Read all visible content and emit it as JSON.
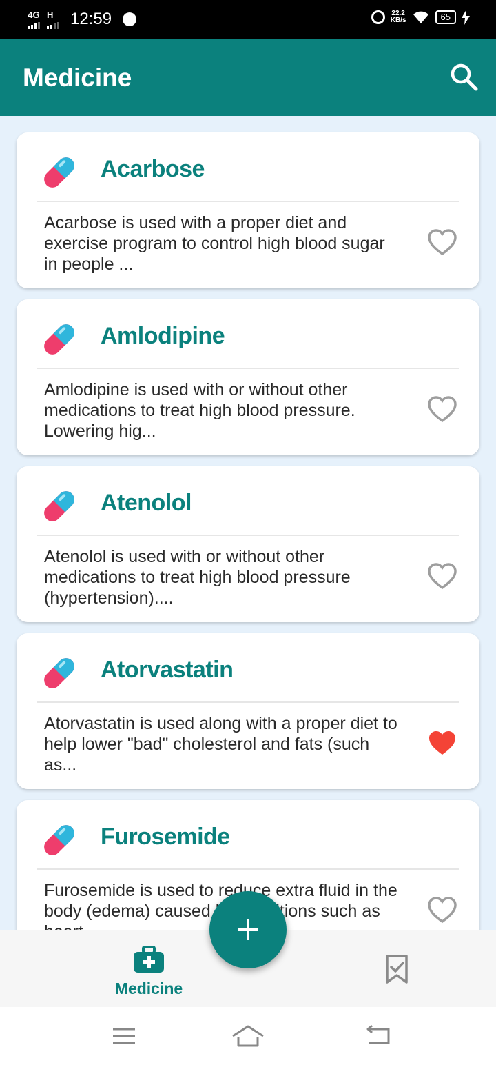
{
  "status_bar": {
    "network_1": "4G",
    "network_2": "H",
    "time": "12:59",
    "speed_value": "22.2",
    "speed_unit": "KB/s",
    "battery": "65"
  },
  "app_bar": {
    "title": "Medicine",
    "search_icon": "search-icon"
  },
  "medicines": [
    {
      "name": "Acarbose",
      "description": "Acarbose is used with a proper diet and exercise program to control high blood sugar in people ...",
      "favorite": false
    },
    {
      "name": "Amlodipine",
      "description": "Amlodipine is used with or without other medications to treat high blood pressure. Lowering hig...",
      "favorite": false
    },
    {
      "name": "Atenolol",
      "description": "Atenolol is used with or without other medications to treat high blood pressure (hypertension)....",
      "favorite": false
    },
    {
      "name": "Atorvastatin",
      "description": "Atorvastatin is used along with a proper diet to help lower \"bad\" cholesterol and fats (such as...",
      "favorite": true
    },
    {
      "name": "Furosemide",
      "description": "Furosemide is used to reduce extra fluid in the body (edema) caused by conditions such as heart",
      "favorite": false
    }
  ],
  "bottom_nav": {
    "medicine_label": "Medicine",
    "medicine_icon": "medical-kit-icon",
    "saved_icon": "bookmark-check-icon"
  },
  "fab_icon": "plus-icon",
  "colors": {
    "primary": "#0b817d",
    "favorite": "#f44336",
    "heart_outline": "#9e9e9e",
    "background": "#e6f1fb"
  }
}
